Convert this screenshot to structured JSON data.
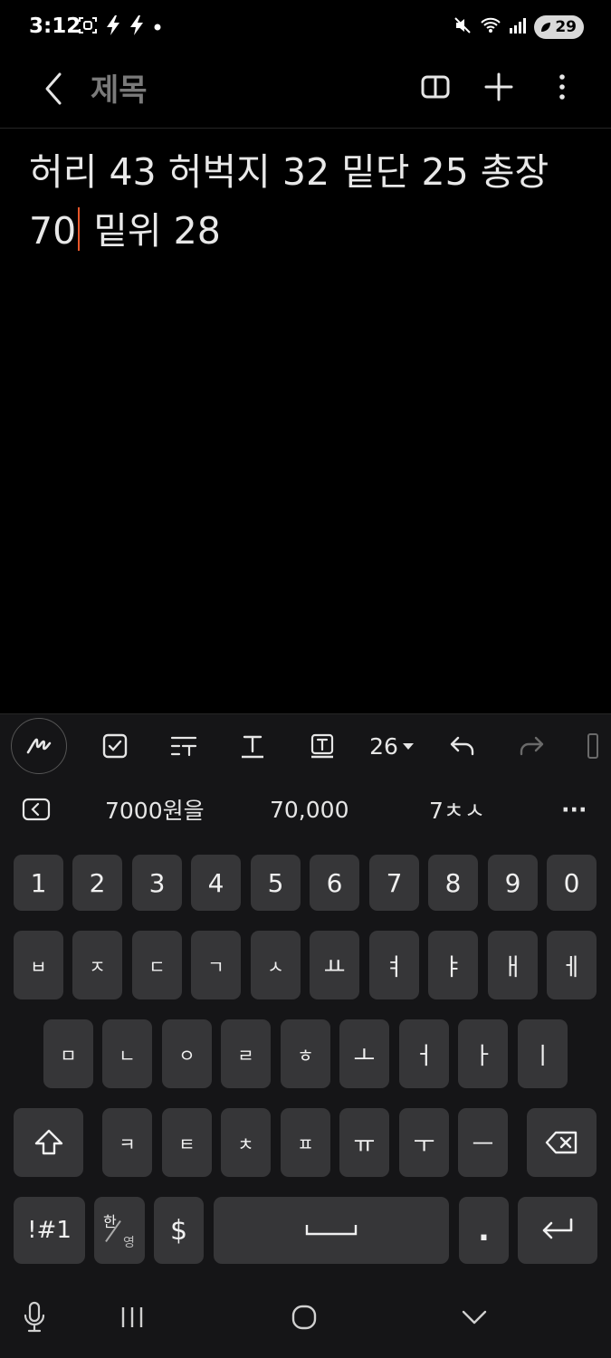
{
  "status_bar": {
    "time": "3:12",
    "left_icons": [
      "screenshot-icon",
      "flash-icon",
      "flash-icon",
      "dot-icon"
    ],
    "right_icons": [
      "mute-icon",
      "wifi-icon",
      "signal-icon"
    ],
    "battery": "29"
  },
  "app_bar": {
    "title": "제목",
    "actions": [
      "reading-mode-icon",
      "add-icon",
      "more-icon"
    ]
  },
  "note": {
    "text_before_cursor": "허리 43 허벅지 32 밑단 25 총장 70",
    "text_after_cursor": " 밑위 28"
  },
  "toolbar": {
    "tools": [
      "pen-icon",
      "checkbox-icon",
      "text-style-icon",
      "text-underline-icon",
      "text-box-icon"
    ],
    "font_size": "26",
    "undo": "undo-icon",
    "redo": "redo-icon"
  },
  "suggestions": {
    "items": [
      "7000원을",
      "70,000",
      "7ㅊㅅ"
    ],
    "more": "···"
  },
  "keyboard": {
    "row1": [
      "1",
      "2",
      "3",
      "4",
      "5",
      "6",
      "7",
      "8",
      "9",
      "0"
    ],
    "row2": [
      "ㅂ",
      "ㅈ",
      "ㄷ",
      "ㄱ",
      "ㅅ",
      "ㅛ",
      "ㅕ",
      "ㅑ",
      "ㅐ",
      "ㅔ"
    ],
    "row3": [
      "ㅁ",
      "ㄴ",
      "ㅇ",
      "ㄹ",
      "ㅎ",
      "ㅗ",
      "ㅓ",
      "ㅏ",
      "ㅣ"
    ],
    "row4": [
      "ㅋ",
      "ㅌ",
      "ㅊ",
      "ㅍ",
      "ㅠ",
      "ㅜ",
      "ㅡ"
    ],
    "symbols_key": "!#1",
    "lang_key_top": "한",
    "lang_key_bottom": "영",
    "currency_key": "$",
    "period_key": "."
  },
  "colors": {
    "background": "#000000",
    "keyboard_bg": "#151517",
    "key_bg": "#363638",
    "caret": "#e8562a",
    "title_gray": "#7a7a7a"
  }
}
